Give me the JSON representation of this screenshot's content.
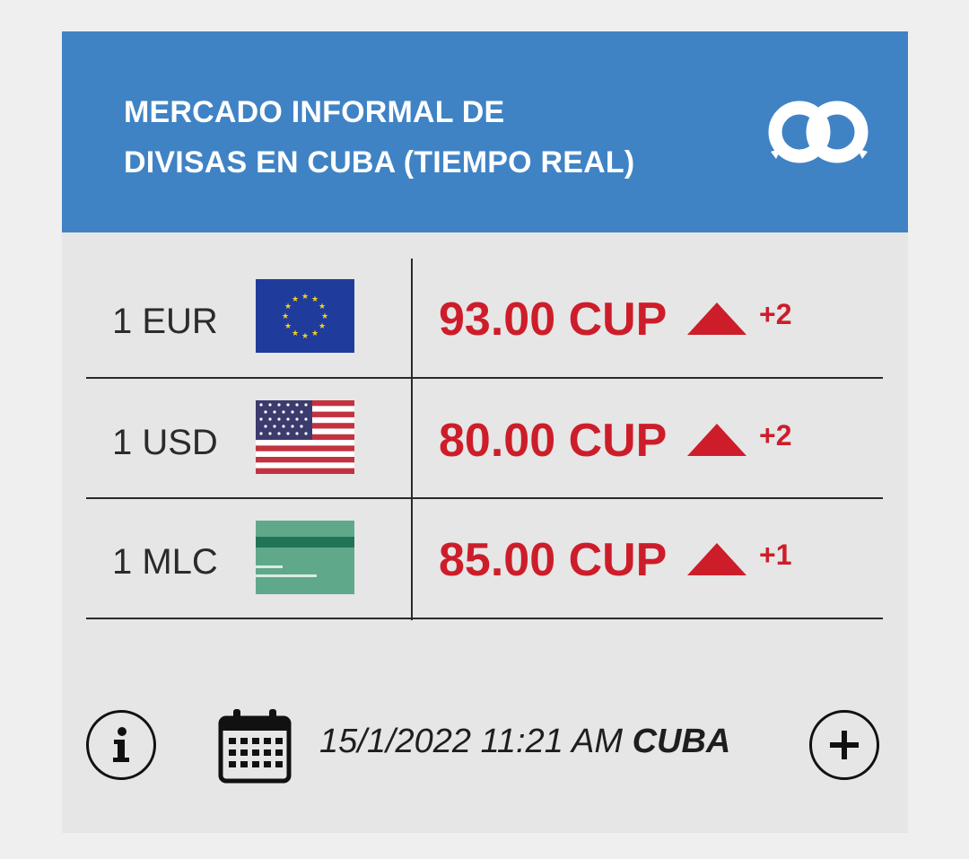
{
  "header": {
    "title_line1": "MERCADO INFORMAL DE",
    "title_line2": "DIVISAS EN CUBA (TIEMPO REAL)",
    "logo_icon": "eltoque-logo-icon",
    "background_color": "#3f83c5"
  },
  "rates": [
    {
      "label": "1 EUR",
      "flag_icon": "eu-flag-icon",
      "value": "93.00 CUP",
      "trend_icon": "up-triangle-icon",
      "change": "+2"
    },
    {
      "label": "1 USD",
      "flag_icon": "us-flag-icon",
      "value": "80.00 CUP",
      "trend_icon": "up-triangle-icon",
      "change": "+2"
    },
    {
      "label": "1 MLC",
      "flag_icon": "mlc-card-icon",
      "value": "85.00 CUP",
      "trend_icon": "up-triangle-icon",
      "change": "+1"
    }
  ],
  "accent_color": "#cd1d2a",
  "footer": {
    "info_icon": "info-icon",
    "calendar_icon": "calendar-icon",
    "date_time": "15/1/2022 11:21 AM",
    "region": "CUBA",
    "plus_icon": "plus-icon"
  }
}
